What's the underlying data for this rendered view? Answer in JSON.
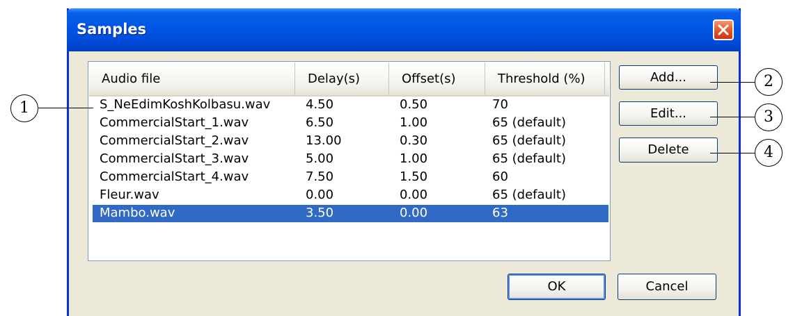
{
  "window": {
    "title": "Samples"
  },
  "list": {
    "columns": [
      "Audio file",
      "Delay(s)",
      "Offset(s)",
      "Threshold (%)"
    ],
    "rows": [
      {
        "file": "S_NeEdimKoshKolbasu.wav",
        "delay": "4.50",
        "offset": "0.50",
        "threshold": "70"
      },
      {
        "file": "CommercialStart_1.wav",
        "delay": "6.50",
        "offset": "1.00",
        "threshold": "65 (default)"
      },
      {
        "file": "CommercialStart_2.wav",
        "delay": "13.00",
        "offset": "0.30",
        "threshold": "65 (default)"
      },
      {
        "file": "CommercialStart_3.wav",
        "delay": "5.00",
        "offset": "1.00",
        "threshold": "65 (default)"
      },
      {
        "file": "CommercialStart_4.wav",
        "delay": "7.50",
        "offset": "1.50",
        "threshold": "60"
      },
      {
        "file": "Fleur.wav",
        "delay": "0.00",
        "offset": "0.00",
        "threshold": "65 (default)"
      },
      {
        "file": "Mambo.wav",
        "delay": "3.50",
        "offset": "0.00",
        "threshold": "63"
      }
    ],
    "selected_file": "Mambo.wav"
  },
  "buttons": {
    "add": "Add...",
    "edit": "Edit...",
    "delete": "Delete",
    "ok": "OK",
    "cancel": "Cancel"
  },
  "callouts": [
    "1",
    "2",
    "3",
    "4"
  ],
  "colors": {
    "selection": "#316ac5",
    "titlebar": "#0055e5",
    "dialog_bg": "#ece9d8"
  },
  "icons": {
    "close": "close-icon"
  }
}
